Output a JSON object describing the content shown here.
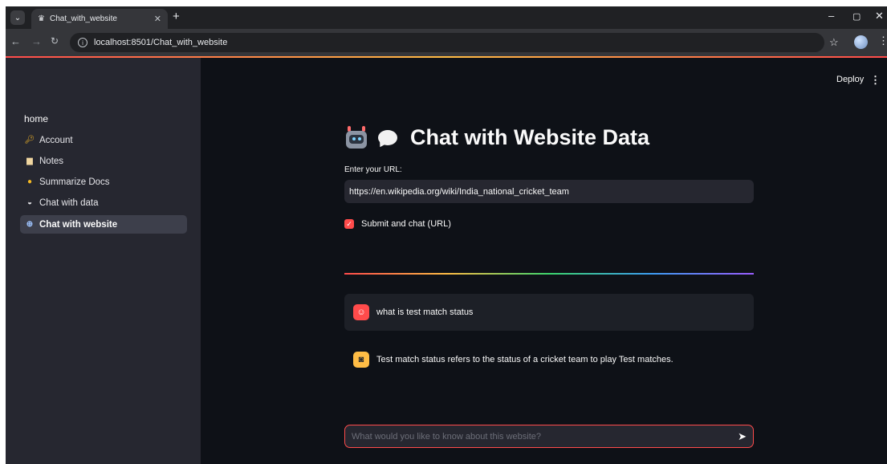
{
  "browser": {
    "tab_title": "Chat_with_website",
    "url": "localhost:8501/Chat_with_website"
  },
  "header": {
    "deploy_label": "Deploy"
  },
  "sidebar": {
    "home_label": "home",
    "items": [
      {
        "label": "Account",
        "icon": "key-icon"
      },
      {
        "label": "Notes",
        "icon": "notebook-icon"
      },
      {
        "label": "Summarize Docs",
        "icon": "emoji-icon"
      },
      {
        "label": "Chat with data",
        "icon": "car-icon"
      },
      {
        "label": "Chat with website",
        "icon": "globe-icon",
        "active": true
      }
    ]
  },
  "main": {
    "title": "Chat with Website Data",
    "url_label": "Enter your URL:",
    "url_value": "https://en.wikipedia.org/wiki/India_national_cricket_team",
    "checkbox_label": "Submit and chat (URL)",
    "checkbox_checked": true,
    "messages": [
      {
        "role": "user",
        "text": "what is test match status"
      },
      {
        "role": "assistant",
        "text": "Test match status refers to the status of a cricket team to play Test matches."
      }
    ],
    "chat_placeholder": "What would you like to know about this website?"
  },
  "colors": {
    "accent": "#ff4b4b",
    "sidebar_bg": "#262730",
    "main_bg": "#0e1117",
    "assistant_avatar": "#ffbd45"
  }
}
